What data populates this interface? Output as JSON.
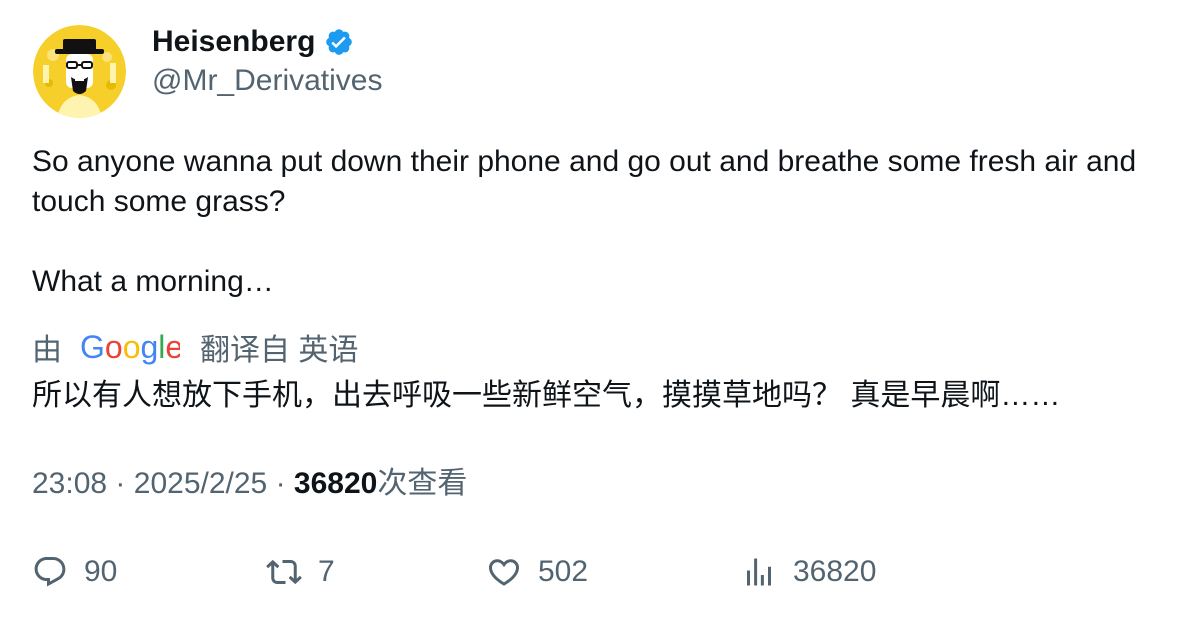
{
  "author": {
    "name": "Heisenberg",
    "handle": "@Mr_Derivatives",
    "verified": true,
    "avatar_icon": "heisenberg-avatar"
  },
  "tweet": {
    "line1": "So anyone wanna put down their phone and go out and breathe some fresh air and touch some grass?",
    "line2": "What a morning…"
  },
  "translation": {
    "prefix": "由",
    "provider": "Google",
    "suffix": "翻译自 英语",
    "text": "所以有人想放下手机，出去呼吸一些新鲜空气，摸摸草地吗？ 真是早晨啊……"
  },
  "meta": {
    "time": "23:08",
    "date": "2025/2/25",
    "views": "36820",
    "views_label": "次查看",
    "separator": "·"
  },
  "actions": {
    "replies": "90",
    "retweets": "7",
    "likes": "502",
    "views": "36820"
  },
  "colors": {
    "primary_text": "#0f1419",
    "secondary_text": "#536471",
    "verified_blue": "#1d9bf0",
    "avatar_yellow": "#f5c518"
  }
}
